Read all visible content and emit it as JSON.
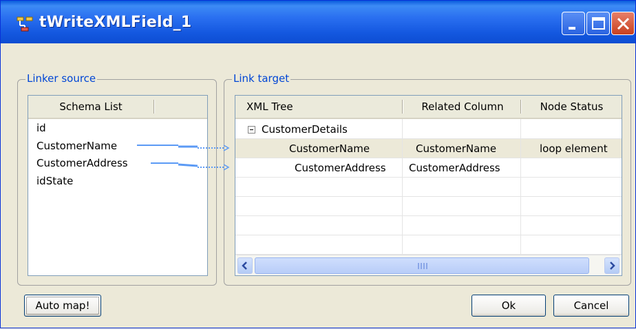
{
  "window": {
    "title": "tWriteXMLField_1"
  },
  "titlebar_buttons": {
    "minimize": "minimize-icon",
    "maximize": "maximize-icon",
    "close": "close-icon"
  },
  "linker_source": {
    "legend": "Linker source",
    "header": "Schema List",
    "items": [
      "id",
      "CustomerName",
      "CustomerAddress",
      "idState"
    ]
  },
  "link_target": {
    "legend": "Link target",
    "columns": [
      "XML Tree",
      "Related Column",
      "Node Status"
    ],
    "rows": [
      {
        "xml_tree": "CustomerDetails",
        "related_column": "",
        "node_status": ""
      },
      {
        "xml_tree": "CustomerName",
        "related_column": "CustomerName",
        "node_status": "loop element"
      },
      {
        "xml_tree": "CustomerAddress",
        "related_column": "CustomerAddress",
        "node_status": ""
      }
    ]
  },
  "buttons": {
    "auto_map": "Auto map!",
    "ok": "Ok",
    "cancel": "Cancel"
  },
  "colors": {
    "title_bar": "#2a6ff0",
    "link_arrow": "#5b9af5",
    "legend_text": "#0046d5"
  }
}
